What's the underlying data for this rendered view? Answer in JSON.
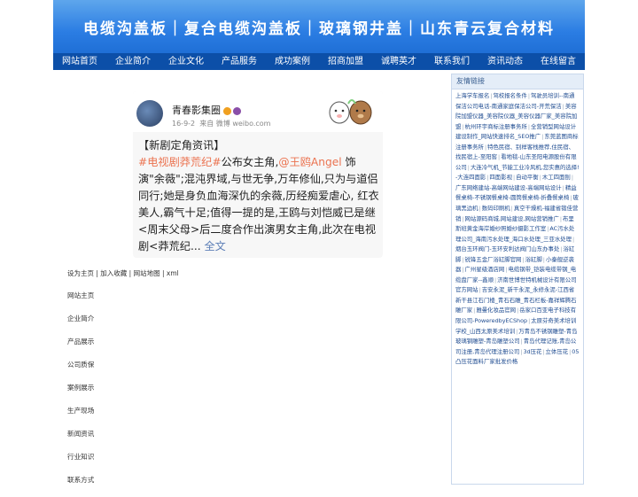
{
  "banner": {
    "title": "电缆沟盖板｜复合电缆沟盖板｜玻璃钢井盖｜山东青云复合材料",
    "colors": {
      "top": "#5ea6ec",
      "bottom": "#1f6fd6"
    }
  },
  "nav": {
    "items": [
      "网站首页",
      "企业简介",
      "企业文化",
      "产品服务",
      "成功案例",
      "招商加盟",
      "诚聘英才",
      "联系我们",
      "资讯动态",
      "在线留言"
    ],
    "color": "#0c4fa8"
  },
  "post": {
    "author": "青春影集圈",
    "date": "16-9-2",
    "source": "来自 微博 weibo.com",
    "line1": "【新剧定角资讯】",
    "tag": "#电视剧莽荒纪#",
    "text1": "公布女主角,",
    "mention": "@王鸥Angel",
    "text2": " 饰演\"余薇\";混沌界域,与世无争,万年修仙,只为与道侣同行;她是身负血海深仇的余薇,历经痴爱虐心, 红衣美人,霸气十足;值得一提的是,王鸥与刘恺威已是继<周末父母>后二度合作出演男女主角,此次在电视剧<莽荒纪... ",
    "more": "全文"
  },
  "toplinks": [
    "设为主页",
    "加入收藏",
    "网站地图",
    "xml"
  ],
  "menu": [
    "网站主页",
    "企业简介",
    "产品展示",
    "公司质保",
    "案例展示",
    "生产现场",
    "新闻资讯",
    "行业知识",
    "联系方式"
  ],
  "sidebar": {
    "title": "友情链接",
    "links": [
      "上海学车报名",
      "驾校报名条件",
      "驾驶员培训--南通保洁公司电话-南通家庭保洁公司-开荒保洁",
      "美容院加盟仪器_美容院仪器_美容仪器厂家_美容院加盟",
      "杭州环宇商标注册事务所",
      "全营销型网站设计建设制作_网站快速排名_SEO推广",
      "东莞蓝图商标注册事务所",
      "特色民宿、别样客栈推荐,住民宿、找民宿上-至阳窖",
      "看地毯-山东圣阳电源股份有限公司",
      "大连冷气机_节能工业冷风机,您实惠的选择!-大连四面影",
      "四面影视",
      "自动平衡",
      "木工四面刨",
      "广东网络建站-高端网站建设-高端网站设计",
      "精益餐桌椅-不锈钢餐桌椅-圆筒餐桌椅-折叠餐桌椅",
      "玻璃黑边机",
      "数码印刷机",
      "真空干燥机-福建省锻佳营销",
      "网站源码商城,网站建设,网站营销推广",
      "布里斯班黄金海岸婚纱照婚纱摄影工作室",
      "AC污水处理公司_海南污水处理_海口水处理_三亚水处理",
      "烟台玉环阀门-玉环安利达阀门山东办事处",
      "浴缸脚",
      "锐锋五金厂浴缸脚官网",
      "浴缸脚",
      "小秦舰逆袭器",
      "广州星级酒店网",
      "电缆钢带_铠装电缆带钢_电缆盘厂家--鑫顺",
      "济南世博世特机械设计有限公司官方网站",
      "吉安永泥_新干永泥_永修永泥-江西省新干县江石门楼_青石石雕_青石栏板-嘉祥辉腾石雕厂家",
      "雅曼化妆品官网",
      "岳家口百亚电子科技有限公司-PoweredbyECShop",
      "太原芬奇美术培训学校_山西太原美术培训",
      "万青岛不锈钢雕塑-青岛玻璃钢雕塑-青岛雕塑公司",
      "青岛代理记账,青岛公司注册,青岛代理注册公司",
      "3d压花",
      "立体压花",
      "05凸压花面料厂家批发价格"
    ]
  }
}
